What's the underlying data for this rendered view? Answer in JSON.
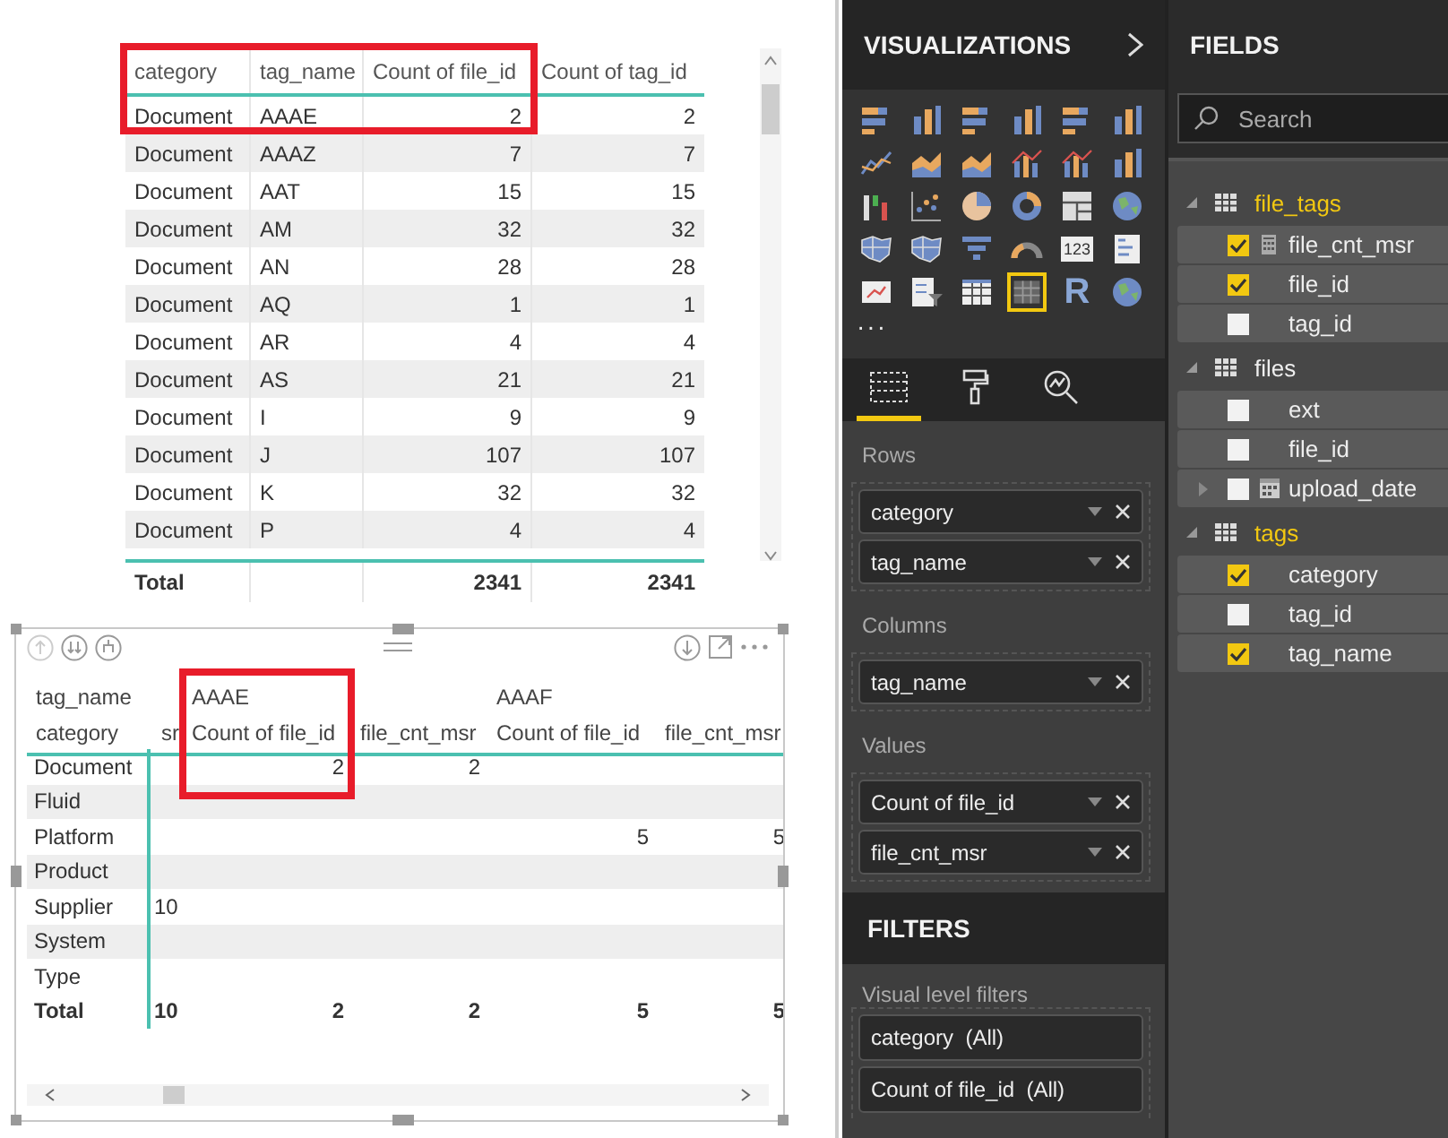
{
  "table": {
    "columns": [
      "category",
      "tag_name",
      "Count of file_id",
      "Count of tag_id"
    ],
    "rows": [
      [
        "Document",
        "AAAE",
        "2",
        "2"
      ],
      [
        "Document",
        "AAAZ",
        "7",
        "7"
      ],
      [
        "Document",
        "AAT",
        "15",
        "15"
      ],
      [
        "Document",
        "AM",
        "32",
        "32"
      ],
      [
        "Document",
        "AN",
        "28",
        "28"
      ],
      [
        "Document",
        "AQ",
        "1",
        "1"
      ],
      [
        "Document",
        "AR",
        "4",
        "4"
      ],
      [
        "Document",
        "AS",
        "21",
        "21"
      ],
      [
        "Document",
        "I",
        "9",
        "9"
      ],
      [
        "Document",
        "J",
        "107",
        "107"
      ],
      [
        "Document",
        "K",
        "32",
        "32"
      ],
      [
        "Document",
        "P",
        "4",
        "4"
      ]
    ],
    "total": {
      "label": "Total",
      "values": [
        "2341",
        "2341"
      ]
    }
  },
  "matrix": {
    "column_header_label": "tag_name",
    "row_header_label": "category",
    "column_groups": [
      "AAAE",
      "AAAF"
    ],
    "value_headers": [
      "sr",
      "Count of file_id",
      "file_cnt_msr",
      "Count of file_id",
      "file_cnt_msr"
    ],
    "rows": [
      {
        "label": "Document",
        "cells": [
          null,
          "2",
          "2",
          null,
          null
        ]
      },
      {
        "label": "Fluid",
        "cells": [
          null,
          null,
          null,
          null,
          null
        ]
      },
      {
        "label": "Platform",
        "cells": [
          null,
          null,
          null,
          "5",
          "5"
        ]
      },
      {
        "label": "Product",
        "cells": [
          null,
          null,
          null,
          null,
          null
        ]
      },
      {
        "label": "Supplier",
        "cells": [
          "10",
          null,
          null,
          null,
          null
        ]
      },
      {
        "label": "System",
        "cells": [
          null,
          null,
          null,
          null,
          null
        ]
      },
      {
        "label": "Type",
        "cells": [
          null,
          null,
          null,
          null,
          null
        ]
      }
    ],
    "total": {
      "label": "Total",
      "cells": [
        "10",
        "2",
        "2",
        "5",
        "5"
      ]
    }
  },
  "visualizations": {
    "title": "VISUALIZATIONS",
    "gallery": [
      {
        "kind": "hbar",
        "selected": false
      },
      {
        "kind": "vbar",
        "selected": false
      },
      {
        "kind": "hbar",
        "selected": false
      },
      {
        "kind": "vbar",
        "selected": false
      },
      {
        "kind": "hbar",
        "selected": false
      },
      {
        "kind": "vbar",
        "selected": false
      },
      {
        "kind": "line",
        "selected": false
      },
      {
        "kind": "area",
        "selected": false
      },
      {
        "kind": "area",
        "selected": false
      },
      {
        "kind": "combo",
        "selected": false
      },
      {
        "kind": "combo",
        "selected": false
      },
      {
        "kind": "vbar",
        "selected": false
      },
      {
        "kind": "waterfall",
        "selected": false
      },
      {
        "kind": "scatter",
        "selected": false
      },
      {
        "kind": "pie",
        "selected": false
      },
      {
        "kind": "donut",
        "selected": false
      },
      {
        "kind": "treemap",
        "selected": false
      },
      {
        "kind": "globe",
        "selected": false
      },
      {
        "kind": "map",
        "selected": false
      },
      {
        "kind": "map",
        "selected": false
      },
      {
        "kind": "funnel",
        "selected": false
      },
      {
        "kind": "gauge",
        "selected": false
      },
      {
        "kind": "card",
        "label": "123",
        "selected": false
      },
      {
        "kind": "multicard",
        "selected": false
      },
      {
        "kind": "kpi",
        "selected": false
      },
      {
        "kind": "slicer",
        "selected": false
      },
      {
        "kind": "table",
        "selected": false
      },
      {
        "kind": "matrix",
        "selected": true
      },
      {
        "kind": "r",
        "label": "R",
        "selected": false
      },
      {
        "kind": "globe",
        "selected": false
      }
    ],
    "more": "···",
    "tabs": [
      {
        "kind": "fields",
        "selected": true
      },
      {
        "kind": "format",
        "selected": false
      },
      {
        "kind": "analytics",
        "selected": false
      }
    ],
    "wells": [
      {
        "label": "Rows",
        "fields": [
          "category",
          "tag_name"
        ]
      },
      {
        "label": "Columns",
        "fields": [
          "tag_name"
        ]
      },
      {
        "label": "Values",
        "fields": [
          "Count of file_id",
          "file_cnt_msr"
        ]
      }
    ]
  },
  "filters": {
    "title": "FILTERS",
    "section": "Visual level filters",
    "items": [
      "category  (All)",
      "Count of file_id  (All)"
    ]
  },
  "fields": {
    "title": "FIELDS",
    "search": {
      "placeholder": "Search"
    },
    "tables": [
      {
        "name": "file_tags",
        "expanded": true,
        "fields": [
          {
            "name": "file_cnt_msr",
            "kind": "measure",
            "checked": true
          },
          {
            "name": "file_id",
            "kind": "column",
            "checked": true
          },
          {
            "name": "tag_id",
            "kind": "column",
            "checked": false
          }
        ]
      },
      {
        "name": "files",
        "expanded": true,
        "fields": [
          {
            "name": "ext",
            "kind": "column",
            "checked": false
          },
          {
            "name": "file_id",
            "kind": "column",
            "checked": false
          },
          {
            "name": "upload_date",
            "kind": "date",
            "checked": false,
            "expanded": false
          }
        ]
      },
      {
        "name": "tags",
        "expanded": true,
        "fields": [
          {
            "name": "category",
            "kind": "column",
            "checked": true
          },
          {
            "name": "tag_id",
            "kind": "column",
            "checked": false
          },
          {
            "name": "tag_name",
            "kind": "column",
            "checked": true
          }
        ]
      }
    ]
  }
}
